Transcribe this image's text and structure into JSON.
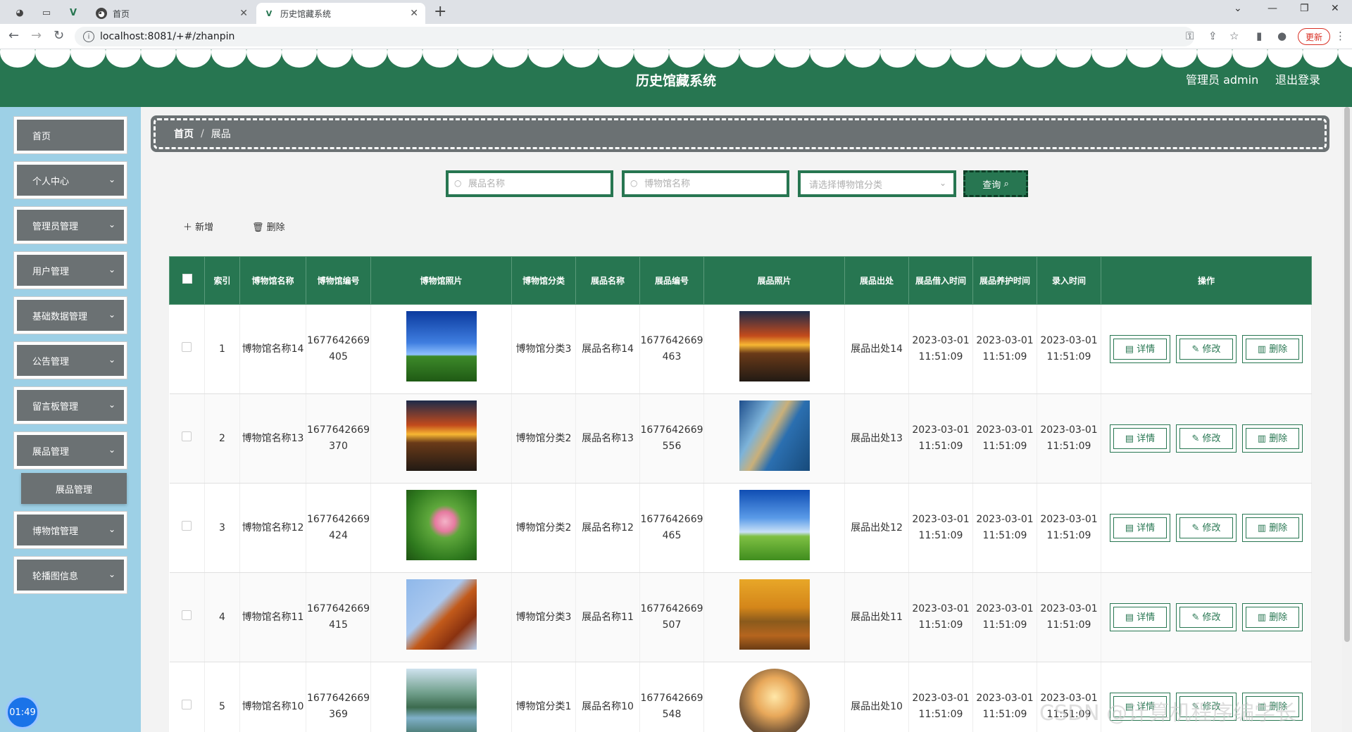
{
  "browser": {
    "tabs": [
      {
        "title": "首页"
      },
      {
        "title": "历史馆藏系统"
      }
    ],
    "url": "localhost:8081/+#/zhanpin",
    "update_label": "更新"
  },
  "header": {
    "title": "历史馆藏系统",
    "user": "管理员 admin",
    "logout": "退出登录"
  },
  "sidebar": {
    "items": [
      {
        "label": "首页"
      },
      {
        "label": "个人中心"
      },
      {
        "label": "管理员管理"
      },
      {
        "label": "用户管理"
      },
      {
        "label": "基础数据管理"
      },
      {
        "label": "公告管理"
      },
      {
        "label": "留言板管理"
      },
      {
        "label": "展品管理"
      },
      {
        "label": "博物馆管理"
      },
      {
        "label": "轮播图信息"
      }
    ],
    "active_sub": "展品管理"
  },
  "breadcrumb": {
    "home": "首页",
    "sep": "/",
    "current": "展品"
  },
  "search": {
    "exhibit_placeholder": "展品名称",
    "museum_placeholder": "博物馆名称",
    "category_placeholder": "请选择博物馆分类",
    "query_label": "查询"
  },
  "actions": {
    "add": "新增",
    "delete": "删除"
  },
  "table": {
    "headers": [
      "索引",
      "博物馆名称",
      "博物馆编号",
      "博物馆照片",
      "博物馆分类",
      "展品名称",
      "展品编号",
      "展品照片",
      "展品出处",
      "展品借入时间",
      "展品养护时间",
      "录入时间",
      "操作"
    ],
    "rows": [
      {
        "index": "1",
        "museum_name": "博物馆名称14",
        "museum_no": "1677642669405",
        "museum_cat": "博物馆分类3",
        "exhibit_name": "展品名称14",
        "exhibit_no": "1677642669463",
        "source": "展品出处14",
        "borrow": "2023-03-01 11:51:09",
        "maintain": "2023-03-01 11:51:09",
        "created": "2023-03-01 11:51:09"
      },
      {
        "index": "2",
        "museum_name": "博物馆名称13",
        "museum_no": "1677642669370",
        "museum_cat": "博物馆分类2",
        "exhibit_name": "展品名称13",
        "exhibit_no": "1677642669556",
        "source": "展品出处13",
        "borrow": "2023-03-01 11:51:09",
        "maintain": "2023-03-01 11:51:09",
        "created": "2023-03-01 11:51:09"
      },
      {
        "index": "3",
        "museum_name": "博物馆名称12",
        "museum_no": "1677642669424",
        "museum_cat": "博物馆分类2",
        "exhibit_name": "展品名称12",
        "exhibit_no": "1677642669465",
        "source": "展品出处12",
        "borrow": "2023-03-01 11:51:09",
        "maintain": "2023-03-01 11:51:09",
        "created": "2023-03-01 11:51:09"
      },
      {
        "index": "4",
        "museum_name": "博物馆名称11",
        "museum_no": "1677642669415",
        "museum_cat": "博物馆分类3",
        "exhibit_name": "展品名称11",
        "exhibit_no": "1677642669507",
        "source": "展品出处11",
        "borrow": "2023-03-01 11:51:09",
        "maintain": "2023-03-01 11:51:09",
        "created": "2023-03-01 11:51:09"
      },
      {
        "index": "5",
        "museum_name": "博物馆名称10",
        "museum_no": "1677642669369",
        "museum_cat": "博物馆分类1",
        "exhibit_name": "展品名称10",
        "exhibit_no": "1677642669548",
        "source": "展品出处10",
        "borrow": "2023-03-01 11:51:09",
        "maintain": "2023-03-01 11:51:09",
        "created": "2023-03-01 11:51:09"
      }
    ],
    "op_labels": {
      "detail": "详情",
      "edit": "修改",
      "delete": "删除"
    }
  },
  "overlay": {
    "clock": "01:49",
    "watermark": "CSDN @计算机程序编学长"
  },
  "colors": {
    "primary": "#277651",
    "menu": "#6b7173",
    "sidebar_bg": "#9dd0e6"
  }
}
